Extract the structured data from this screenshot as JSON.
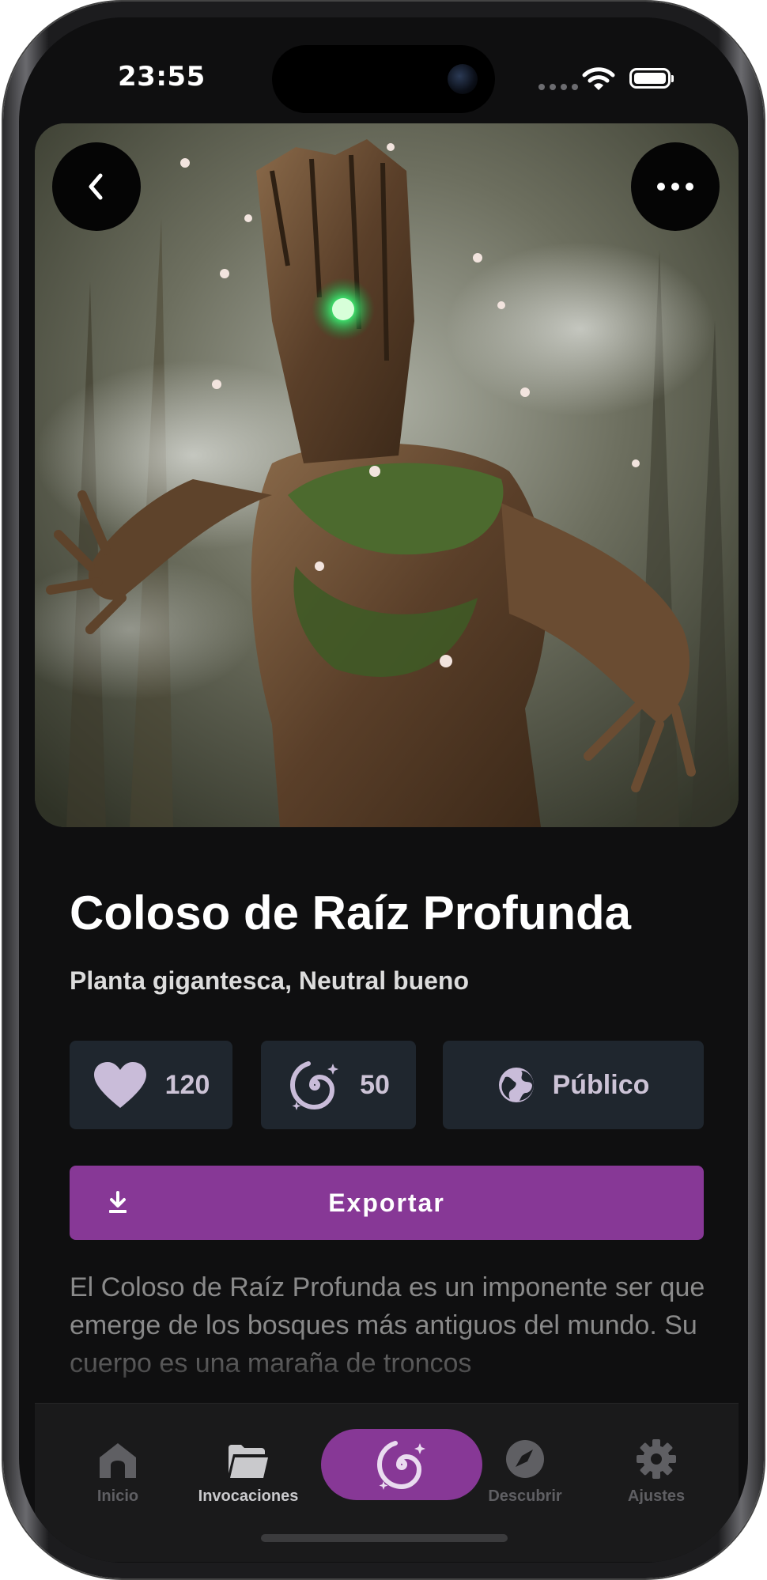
{
  "status_bar": {
    "time": "23:55"
  },
  "creature": {
    "name": "Coloso de Raíz Profunda",
    "subtitle": "Planta gigantesca, Neutral bueno",
    "description": "El Coloso de Raíz Profunda es un imponente ser que emerge de los bosques más antiguos del mundo. Su cuerpo es una maraña de troncos"
  },
  "stats": {
    "likes": "120",
    "summons": "50",
    "visibility": "Público"
  },
  "actions": {
    "export_label": "Exportar"
  },
  "tabbar": {
    "home": "Inicio",
    "invocations": "Invocaciones",
    "discover": "Descubrir",
    "settings": "Ajustes"
  },
  "colors": {
    "accent": "#873896",
    "stat_bg": "#1f262e",
    "stat_icon": "#c9bcd9",
    "background": "#0f0f10"
  },
  "icons": [
    "back-icon",
    "more-icon",
    "heart-icon",
    "spiral-icon",
    "globe-icon",
    "download-icon",
    "home-icon",
    "folder-icon",
    "compass-icon",
    "gear-icon"
  ]
}
